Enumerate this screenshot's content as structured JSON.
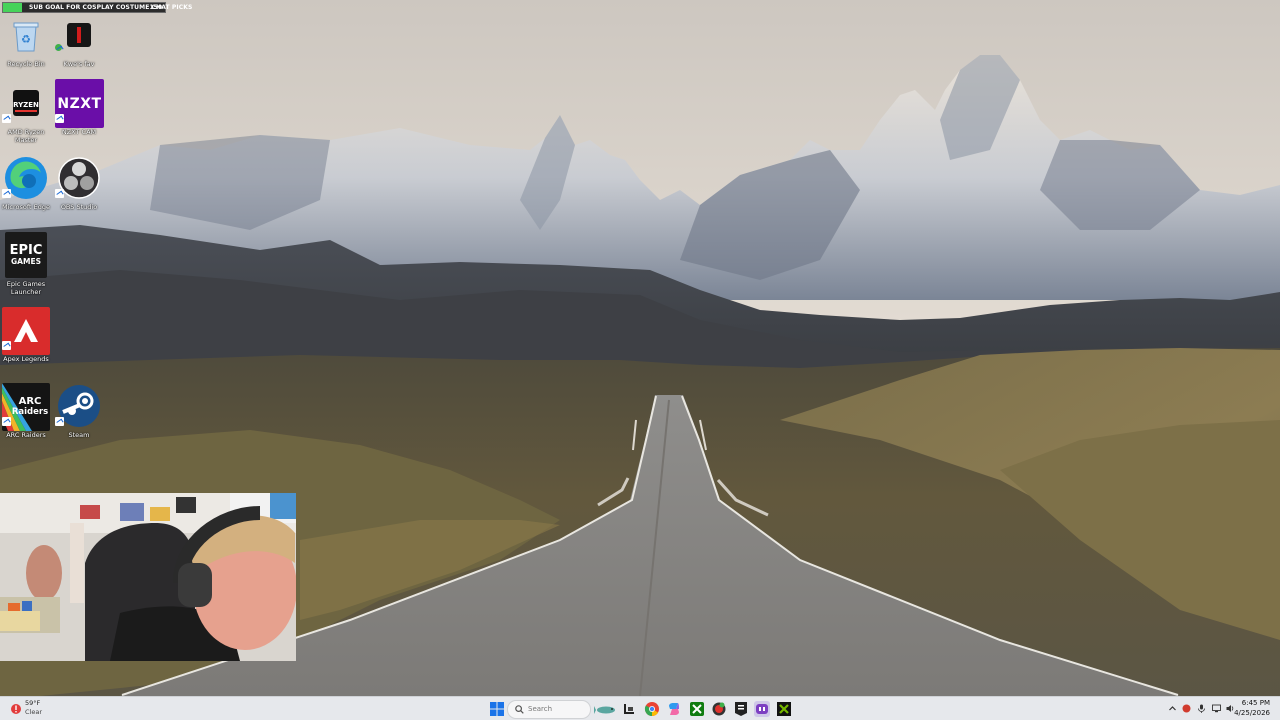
{
  "goal_bar": {
    "label": "SUB GOAL FOR COSPLAY COSTUME CHAT PICKS",
    "count": "150",
    "progress_fraction": 0.12,
    "fill_color": "#46d35a"
  },
  "desktop_icons": [
    {
      "label": "Recycle Bin",
      "icon": "recycle-bin-icon"
    },
    {
      "label": "Kwe's fav",
      "icon": "kwe-fav-icon"
    },
    {
      "label": "AMD Ryzen Master",
      "icon": "ryzen-master-icon"
    },
    {
      "label": "NZXT CAM",
      "icon": "nzxt-cam-icon",
      "tile_text": "NZXT"
    },
    {
      "label": "Microsoft Edge",
      "icon": "edge-icon"
    },
    {
      "label": "OBS Studio",
      "icon": "obs-icon"
    },
    {
      "label": "Epic Games Launcher",
      "icon": "epic-games-icon",
      "tile_text_1": "EPIC",
      "tile_text_2": "GAMES"
    },
    {
      "label": "Apex Legends",
      "icon": "apex-legends-icon"
    },
    {
      "label": "ARC Raiders",
      "icon": "arc-raiders-icon",
      "tile_text_1": "ARC",
      "tile_text_2": "Raiders"
    },
    {
      "label": "Steam",
      "icon": "steam-icon"
    }
  ],
  "taskbar": {
    "weather": {
      "temp": "59°F",
      "desc": "Clear",
      "icon": "weather-alert-icon"
    },
    "search_label": "Search",
    "pinned": [
      {
        "name": "start-button",
        "icon": "windows-logo-icon"
      },
      {
        "name": "widgets-button",
        "icon": "fish-widget-icon"
      },
      {
        "name": "file-explorer-taskbar-button",
        "icon": "file-explorer-icon"
      },
      {
        "name": "chrome-taskbar-button",
        "icon": "chrome-icon"
      },
      {
        "name": "copilot-taskbar-button",
        "icon": "copilot-icon"
      },
      {
        "name": "xbox-taskbar-button",
        "icon": "xbox-icon"
      },
      {
        "name": "red-app-taskbar-button",
        "icon": "red-app-icon"
      },
      {
        "name": "epic-taskbar-button",
        "icon": "epic-games-icon"
      },
      {
        "name": "obs-taskbar-button",
        "icon": "obs-icon"
      },
      {
        "name": "streamlabs-taskbar-button",
        "icon": "streamlabs-icon"
      },
      {
        "name": "nvidia-taskbar-button",
        "icon": "nvidia-icon"
      }
    ],
    "clock": {
      "time": "6:45 PM",
      "date": "4/25/2026"
    }
  }
}
